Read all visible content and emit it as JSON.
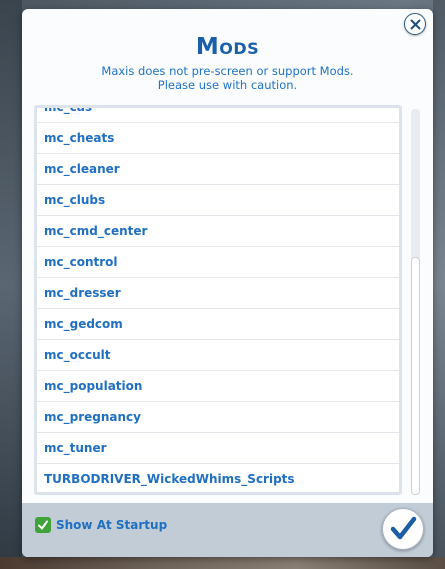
{
  "dialog": {
    "title": "Mods",
    "subtitle_line1": "Maxis does not pre-screen or support Mods.",
    "subtitle_line2": "Please use with caution."
  },
  "mods": {
    "items": [
      {
        "label": "mc_cas"
      },
      {
        "label": "mc_cheats"
      },
      {
        "label": "mc_cleaner"
      },
      {
        "label": "mc_clubs"
      },
      {
        "label": "mc_cmd_center"
      },
      {
        "label": "mc_control"
      },
      {
        "label": "mc_dresser"
      },
      {
        "label": "mc_gedcom"
      },
      {
        "label": "mc_occult"
      },
      {
        "label": "mc_population"
      },
      {
        "label": "mc_pregnancy"
      },
      {
        "label": "mc_tuner"
      },
      {
        "label": "TURBODRIVER_WickedWhims_Scripts"
      }
    ]
  },
  "footer": {
    "show_at_startup_label": "Show At Startup",
    "show_at_startup_checked": true
  },
  "icons": {
    "close": "close-icon",
    "confirm": "checkmark-icon",
    "checkbox": "checkbox-check-icon"
  },
  "colors": {
    "accent": "#1f6fc2",
    "title": "#1a5fa8",
    "checkbox": "#3fa33a",
    "footer": "#c2ccd7"
  }
}
